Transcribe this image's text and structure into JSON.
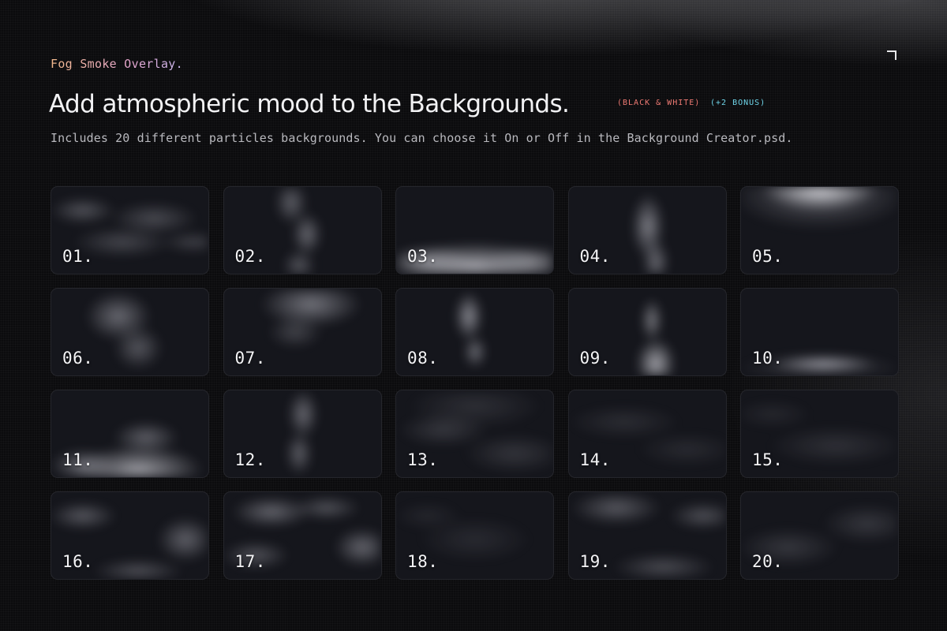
{
  "header": {
    "eyebrow": "Fog Smoke Overlay.",
    "headline": "Add atmospheric mood to the Backgrounds.",
    "tag_bw": "(BLACK & WHITE)",
    "tag_bonus": "(+2 BONUS)",
    "subhead": "Includes 20 different particles backgrounds. You can choose it On or Off in the Background Creator.psd."
  },
  "colors": {
    "background": "#0b0b0d",
    "tile": "#15161c",
    "tag_bw": "#f07b74",
    "tag_bonus": "#6fd6ea",
    "eyebrow_start": "#f2b98c",
    "eyebrow_end": "#c9b7f0"
  },
  "icons": {
    "corner": "corner-bracket-icon"
  },
  "tiles": [
    {
      "label": "01."
    },
    {
      "label": "02."
    },
    {
      "label": "03."
    },
    {
      "label": "04."
    },
    {
      "label": "05."
    },
    {
      "label": "06."
    },
    {
      "label": "07."
    },
    {
      "label": "08."
    },
    {
      "label": "09."
    },
    {
      "label": "10."
    },
    {
      "label": "11."
    },
    {
      "label": "12."
    },
    {
      "label": "13."
    },
    {
      "label": "14."
    },
    {
      "label": "15."
    },
    {
      "label": "16."
    },
    {
      "label": "17."
    },
    {
      "label": "18."
    },
    {
      "label": "19."
    },
    {
      "label": "20."
    }
  ]
}
